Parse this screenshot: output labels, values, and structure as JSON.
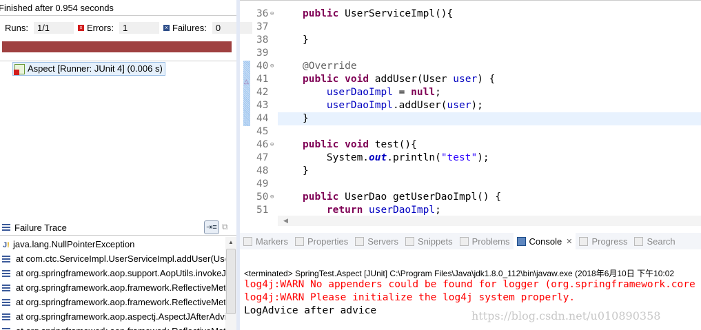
{
  "junit": {
    "status": "Finished after 0.954 seconds",
    "runs_label": "Runs:",
    "runs": "1/1",
    "errors_label": "Errors:",
    "errors": "1",
    "failures_label": "Failures:",
    "failures": "0",
    "progress_state": "failed",
    "progress_fraction": 1.0,
    "test_item": "Aspect [Runner: JUnit 4] (0.006 s)"
  },
  "failure_trace": {
    "title": "Failure Trace",
    "exception": "java.lang.NullPointerException",
    "frames": [
      "at com.ctc.ServiceImpl.UserServiceImpl.addUser(UserServiceImpl.java",
      "at org.springframework.aop.support.AopUtils.invokeJoinpointUsingReflection",
      "at org.springframework.aop.framework.ReflectiveMethodInvocation",
      "at org.springframework.aop.framework.ReflectiveMethodInvocation",
      "at org.springframework.aop.aspectj.AspectJAfterAdvice",
      "at org.springframework.aop.framework.ReflectiveMethodInvocation"
    ]
  },
  "editor": {
    "lines": [
      {
        "n": "36",
        "fold": true,
        "tokens": [
          [
            "kw",
            "public"
          ],
          [
            "p",
            " UserServiceImpl(){"
          ]
        ]
      },
      {
        "n": "37",
        "tokens": []
      },
      {
        "n": "38",
        "tokens": [
          [
            "p",
            "}"
          ]
        ]
      },
      {
        "n": "39",
        "tokens": []
      },
      {
        "n": "40",
        "fold": true,
        "tokens": [
          [
            "ann",
            "@Override"
          ]
        ]
      },
      {
        "n": "41",
        "tokens": [
          [
            "kw",
            "public"
          ],
          [
            "p",
            " "
          ],
          [
            "kw",
            "void"
          ],
          [
            "p",
            " addUser(User "
          ],
          [
            "var",
            "user"
          ],
          [
            "p",
            ") {"
          ]
        ]
      },
      {
        "n": "42",
        "indent": true,
        "tokens": [
          [
            "var",
            "userDaoImpl"
          ],
          [
            "p",
            " = "
          ],
          [
            "kw",
            "null"
          ],
          [
            "p",
            ";"
          ]
        ]
      },
      {
        "n": "43",
        "indent": true,
        "tokens": [
          [
            "var",
            "userDaoImpl"
          ],
          [
            "p",
            ".addUser("
          ],
          [
            "var",
            "user"
          ],
          [
            "p",
            ");"
          ]
        ]
      },
      {
        "n": "44",
        "current": true,
        "tokens": [
          [
            "p",
            "}"
          ]
        ]
      },
      {
        "n": "45",
        "tokens": []
      },
      {
        "n": "46",
        "fold": true,
        "tokens": [
          [
            "kw",
            "public"
          ],
          [
            "p",
            " "
          ],
          [
            "kw",
            "void"
          ],
          [
            "p",
            " test(){"
          ]
        ]
      },
      {
        "n": "47",
        "indent": true,
        "tokens": [
          [
            "p",
            "System."
          ],
          [
            "st",
            "out"
          ],
          [
            "p",
            ".println("
          ],
          [
            "str",
            "\"test\""
          ],
          [
            "p",
            ");"
          ]
        ]
      },
      {
        "n": "48",
        "tokens": [
          [
            "p",
            "}"
          ]
        ]
      },
      {
        "n": "49",
        "tokens": []
      },
      {
        "n": "50",
        "fold": true,
        "tokens": [
          [
            "kw",
            "public"
          ],
          [
            "p",
            " UserDao getUserDaoImpl() {"
          ]
        ]
      },
      {
        "n": "51",
        "indent": true,
        "tokens": [
          [
            "kw",
            "return"
          ],
          [
            "p",
            " "
          ],
          [
            "var",
            "userDaoImpl"
          ],
          [
            "p",
            ";"
          ]
        ]
      }
    ]
  },
  "bottom": {
    "tabs": [
      {
        "label": "Markers"
      },
      {
        "label": "Properties"
      },
      {
        "label": "Servers"
      },
      {
        "label": "Snippets"
      },
      {
        "label": "Problems"
      },
      {
        "label": "Console",
        "active": true
      },
      {
        "label": "Progress"
      },
      {
        "label": "Search"
      }
    ],
    "terminated": "<terminated> SpringTest.Aspect [JUnit] C:\\Program Files\\Java\\jdk1.8.0_112\\bin\\javaw.exe (2018年6月10日 下午10:02",
    "output": [
      {
        "text": "log4j:WARN No appenders could be found for logger (org.springframework.core",
        "err": true
      },
      {
        "text": "log4j:WARN Please initialize the log4j system properly.",
        "err": true
      },
      {
        "text": "LogAdvice after advice",
        "err": false
      }
    ],
    "watermark": "https://blog.csdn.net/u010890358"
  },
  "colors": {
    "failure_bar": "#9f4040",
    "keyword": "#7f0055",
    "field": "#0000c0",
    "error_text": "#ff0000"
  }
}
